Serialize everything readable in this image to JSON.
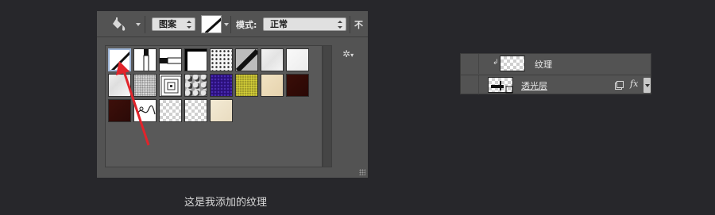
{
  "options_bar": {
    "fill_source": "图案",
    "mode_label": "模式:",
    "mode_value": "正常",
    "opacity_label_cut": "不"
  },
  "pattern_picker": {
    "tiles": [
      {
        "name": "diagonal-line",
        "style": "diag",
        "selected": true
      },
      {
        "name": "vertical-bar",
        "style": "vbar"
      },
      {
        "name": "horizontal-bar",
        "style": "hbar"
      },
      {
        "name": "black-frame",
        "style": "frame"
      },
      {
        "name": "dots",
        "style": "dots"
      },
      {
        "name": "dark-diagonal",
        "style": "diag2"
      },
      {
        "name": "light-gray-texture",
        "style": "ltex"
      },
      {
        "name": "white-texture",
        "style": "wtex"
      },
      {
        "name": "light-texture-2",
        "style": "ltex2"
      },
      {
        "name": "gray-noise",
        "style": "noise"
      },
      {
        "name": "concentric-squares",
        "style": "conc"
      },
      {
        "name": "rock-texture",
        "style": "rock"
      },
      {
        "name": "blue-texture",
        "style": "blue"
      },
      {
        "name": "yellow-texture",
        "style": "yellow"
      },
      {
        "name": "cream-texture",
        "style": "cream"
      },
      {
        "name": "dark-red-texture",
        "style": "darkred"
      },
      {
        "name": "dark-brown-texture",
        "style": "darkbrown"
      },
      {
        "name": "doodle",
        "style": "doodle"
      },
      {
        "name": "transparent-1",
        "style": "checker"
      },
      {
        "name": "transparent-2",
        "style": "checker"
      },
      {
        "name": "parchment",
        "style": "parch"
      }
    ]
  },
  "caption": "这是我添加的纹理",
  "layers": {
    "row1_name": "纹理",
    "row2_name": "透光层",
    "fx_label": "fx"
  },
  "colors": {
    "accent_arrow": "#e0242b"
  }
}
